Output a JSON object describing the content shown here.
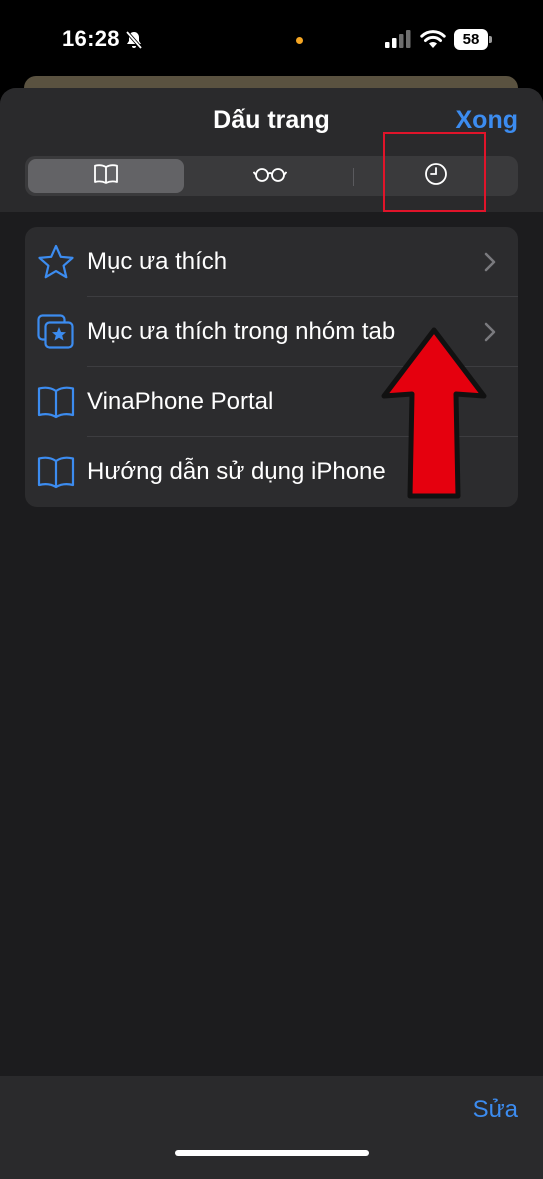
{
  "status": {
    "time": "16:28",
    "battery": "58"
  },
  "sheet": {
    "title": "Dấu trang",
    "done_label": "Xong",
    "segments": [
      {
        "icon": "book-icon",
        "selected": true
      },
      {
        "icon": "glasses-icon",
        "selected": false
      },
      {
        "icon": "clock-icon",
        "selected": false
      }
    ]
  },
  "list": {
    "items": [
      {
        "label": "Mục ưa thích",
        "icon": "star-icon",
        "has_chevron": true
      },
      {
        "label": "Mục ưa thích trong nhóm tab",
        "icon": "tab-group-star-icon",
        "has_chevron": true
      },
      {
        "label": "VinaPhone Portal",
        "icon": "book-icon",
        "has_chevron": false
      },
      {
        "label": "Hướng dẫn sử dụng iPhone",
        "icon": "book-icon",
        "has_chevron": false
      }
    ]
  },
  "bottom": {
    "edit_label": "Sửa"
  },
  "colors": {
    "accent": "#3c8cf0",
    "annotation": "#e0142a",
    "sheet_bg": "#1c1c1e",
    "row_bg": "#2c2c2e"
  }
}
